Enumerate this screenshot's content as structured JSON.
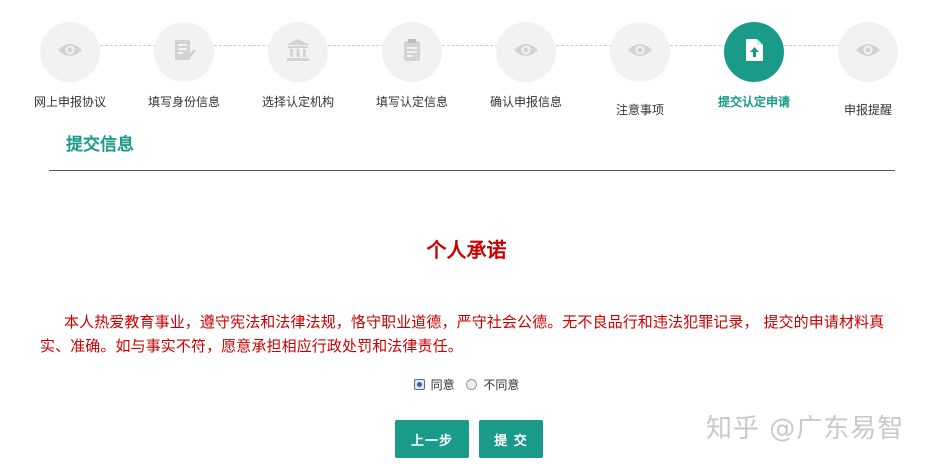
{
  "steps": [
    {
      "label": "网上申报协议",
      "icon": "eye-icon",
      "active": false
    },
    {
      "label": "填写身份信息",
      "icon": "edit-document-icon",
      "active": false
    },
    {
      "label": "选择认定机构",
      "icon": "institution-icon",
      "active": false
    },
    {
      "label": "填写认定信息",
      "icon": "clipboard-icon",
      "active": false
    },
    {
      "label": "确认申报信息",
      "icon": "eye-icon",
      "active": false
    },
    {
      "label": "注意事项",
      "icon": "eye-icon",
      "active": false
    },
    {
      "label": "提交认定申请",
      "icon": "upload-file-icon",
      "active": true
    },
    {
      "label": "申报提醒",
      "icon": "eye-icon",
      "active": false
    }
  ],
  "section_title": "提交信息",
  "commitment": {
    "heading": "个人承诺",
    "text": "本人热爱教育事业，遵守宪法和法律法规，恪守职业道德，严守社会公德。无不良品行和违法犯罪记录， 提交的申请材料真实、准确。如与事实不符，愿意承担相应行政处罚和法律责任。"
  },
  "agreement": {
    "agree_label": "同意",
    "disagree_label": "不同意",
    "selected": "agree"
  },
  "buttons": {
    "prev_label": "上一步",
    "submit_label": "提 交"
  },
  "watermark": "知乎 @广东易智",
  "colors": {
    "accent": "#1a9b8a",
    "warning_text": "#cc0000"
  }
}
